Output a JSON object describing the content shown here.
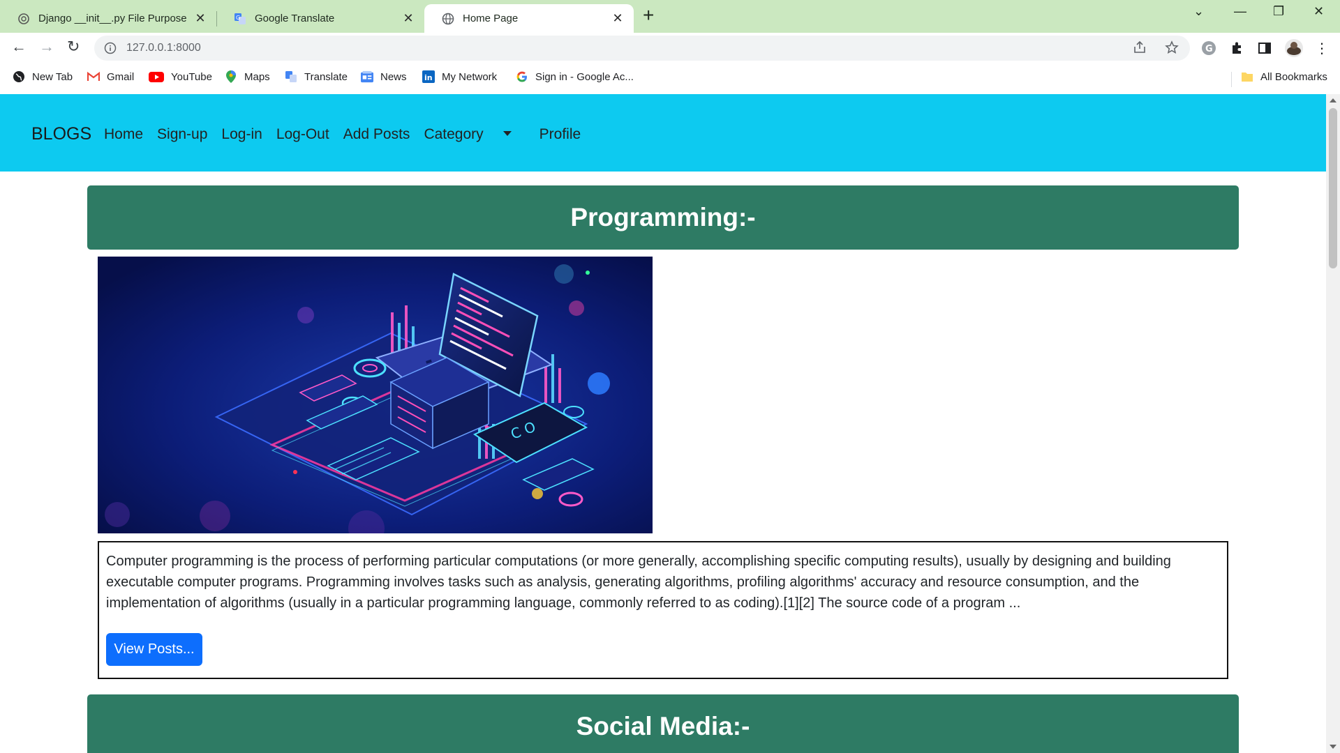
{
  "browser": {
    "tabs": [
      {
        "label": "Django __init__.py File Purpose",
        "icon": "openai-icon",
        "active": false
      },
      {
        "label": "Google Translate",
        "icon": "translate-icon",
        "active": false
      },
      {
        "label": "Home Page",
        "icon": "globe-icon",
        "active": true
      }
    ],
    "url": "127.0.0.1:8000",
    "bookmarks": [
      {
        "label": "New Tab",
        "icon": "globe-icon"
      },
      {
        "label": "Gmail",
        "icon": "gmail-icon"
      },
      {
        "label": "YouTube",
        "icon": "youtube-icon"
      },
      {
        "label": "Maps",
        "icon": "maps-icon"
      },
      {
        "label": "Translate",
        "icon": "translate-icon"
      },
      {
        "label": "News",
        "icon": "news-icon"
      },
      {
        "label": "My Network",
        "icon": "linkedin-icon"
      },
      {
        "label": "Sign in - Google Ac...",
        "icon": "google-icon"
      }
    ],
    "all_bookmarks": "All Bookmarks"
  },
  "site": {
    "brand": "BLOGS",
    "nav": [
      "Home",
      "Sign-up",
      "Log-in",
      "Log-Out",
      "Add Posts",
      "Category",
      "Profile"
    ],
    "colors": {
      "navbar": "#0dcaf0",
      "category_header": "#2e7b64",
      "button": "#0d6efd"
    }
  },
  "categories": [
    {
      "title": "Programming:-",
      "image": "programming-isometric-illustration",
      "description": "Computer programming is the process of performing particular computations (or more generally, accomplishing specific computing results), usually by designing and building executable computer programs. Programming involves tasks such as analysis, generating algorithms, profiling algorithms' accuracy and resource consumption, and the implementation of algorithms (usually in a particular programming language, commonly referred to as coding).[1][2] The source code of a program ...",
      "button": "View Posts..."
    },
    {
      "title": "Social Media:-"
    }
  ]
}
